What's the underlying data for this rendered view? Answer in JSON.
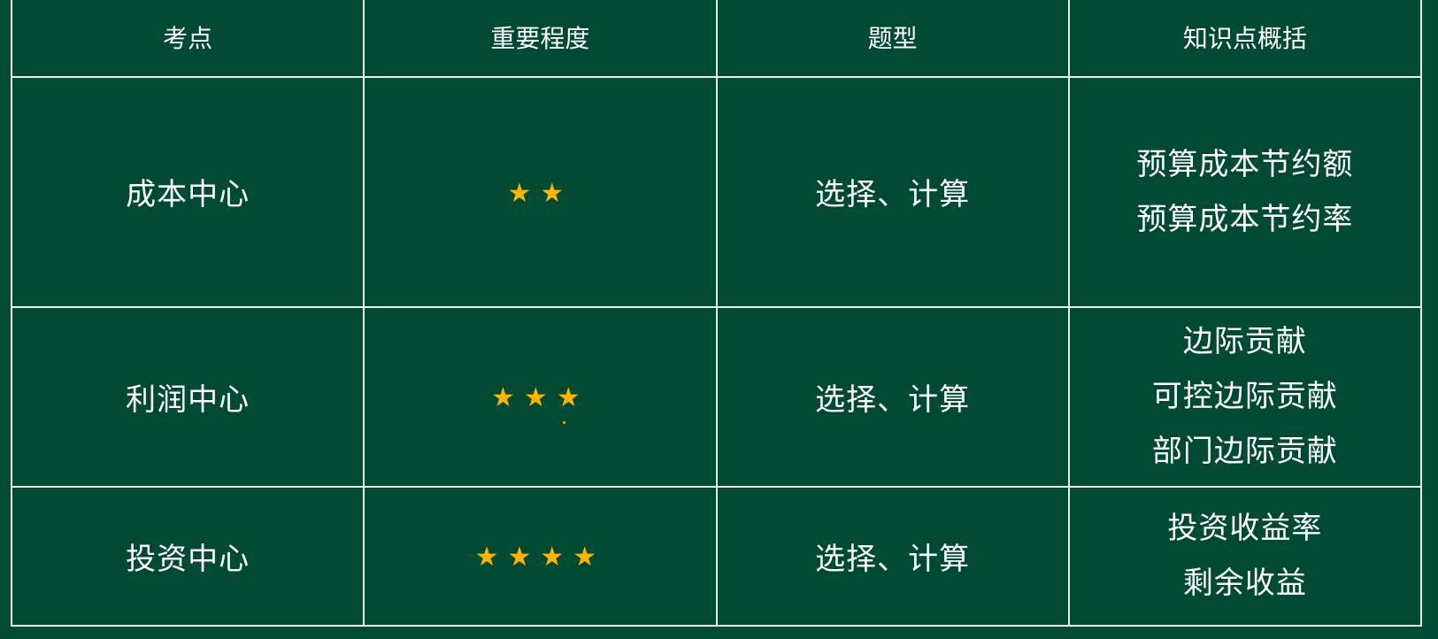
{
  "title_overlay": "",
  "table": {
    "headers": [
      "考点",
      "重要程度",
      "题型",
      "知识点概括"
    ],
    "rows": [
      {
        "topic": "成本中心",
        "importance_stars": 2,
        "stars_text": "★★",
        "question_type": "选择、计算",
        "knowledge": [
          "预算成本节约额",
          "预算成本节约率"
        ]
      },
      {
        "topic": "利润中心",
        "importance_stars": 3,
        "stars_text": "★★★",
        "question_type": "选择、计算",
        "knowledge": [
          "边际贡献",
          "可控边际贡献",
          "部门边际贡献"
        ]
      },
      {
        "topic": "投资中心",
        "importance_stars": 4,
        "stars_text": "★★★★",
        "question_type": "选择、计算",
        "knowledge": [
          "投资收益率",
          "剩余收益"
        ]
      }
    ]
  },
  "colors": {
    "background": "#004a33",
    "border": "#e8efe9",
    "text": "#ffffff",
    "star": "#ffb400",
    "title": "#ffe500"
  }
}
